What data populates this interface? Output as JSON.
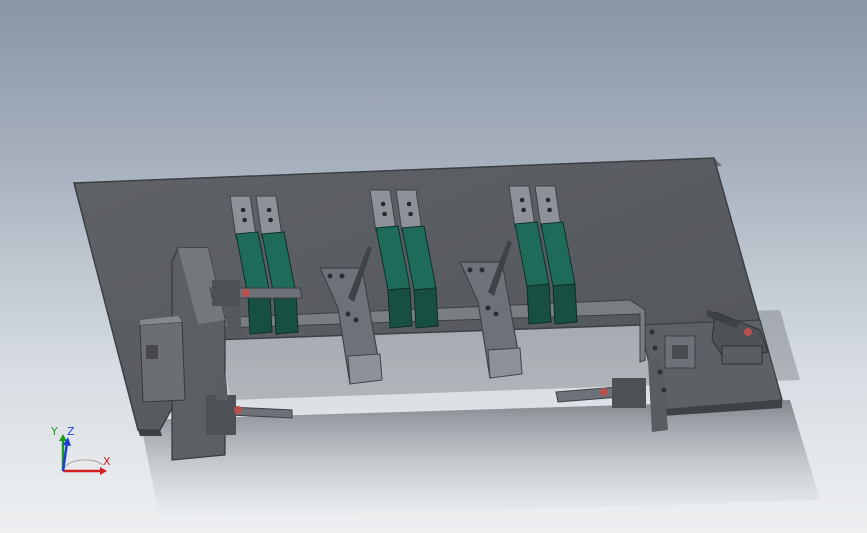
{
  "viewport": {
    "background_top": "#8a96a6",
    "background_bottom": "#eef0f2"
  },
  "model": {
    "plate_color": "#5a5d62",
    "plate_edge_color": "#3c3f44",
    "block_color": "#1f6b5a",
    "block_dark_color": "#174f43",
    "metal_color": "#6e7177",
    "metal_light_color": "#8e9197",
    "metal_dark_color": "#3f4247",
    "clamp_red": "#b84f4f",
    "clamp_count": 4,
    "slider_count": 3,
    "block_group_count": 3
  },
  "triad": {
    "x_label": "X",
    "y_label": "Y",
    "z_label": "Z",
    "x_color": "#d32020",
    "y_color": "#1e9a1e",
    "z_color": "#1f3fd3"
  }
}
